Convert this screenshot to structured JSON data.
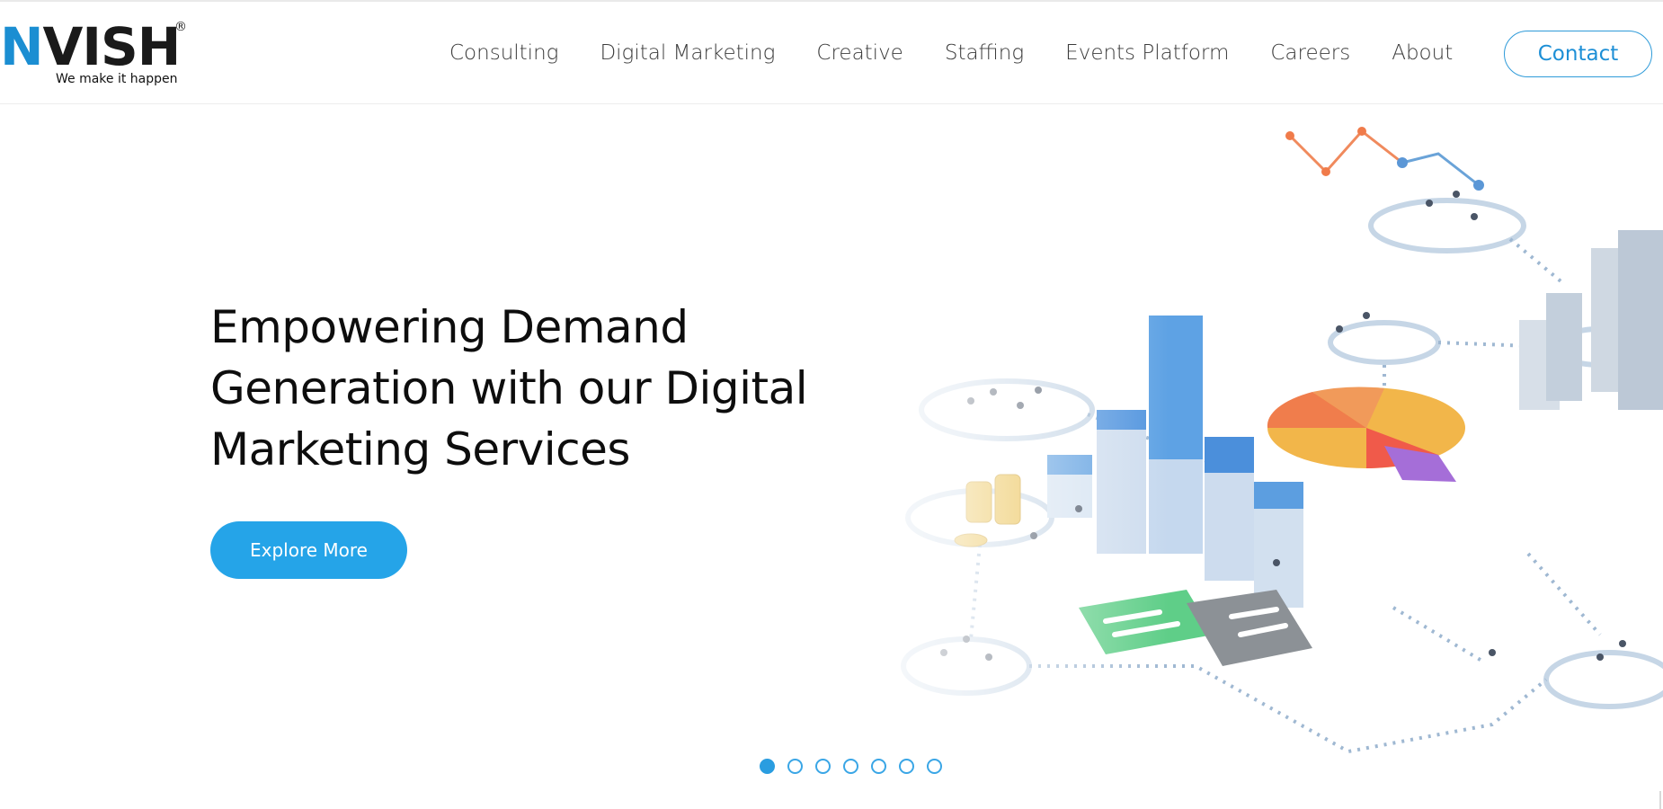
{
  "brand": {
    "name": "NVISH",
    "name_first": "N",
    "name_rest": "VISH",
    "registered": "®",
    "tagline": "We make it happen",
    "accent_color": "#1b8ed2"
  },
  "nav": {
    "items": [
      {
        "label": "Consulting"
      },
      {
        "label": "Digital Marketing"
      },
      {
        "label": "Creative"
      },
      {
        "label": "Staffing"
      },
      {
        "label": "Events Platform"
      },
      {
        "label": "Careers"
      },
      {
        "label": "About"
      }
    ],
    "contact_label": "Contact"
  },
  "hero": {
    "headline": "Empowering Demand Generation with our Digital Marketing Services",
    "cta_label": "Explore More",
    "cta_color": "#25a4e8",
    "image_description_icon": "business-analytics-illustration",
    "slider": {
      "total_slides": 7,
      "active_index": 1
    }
  }
}
